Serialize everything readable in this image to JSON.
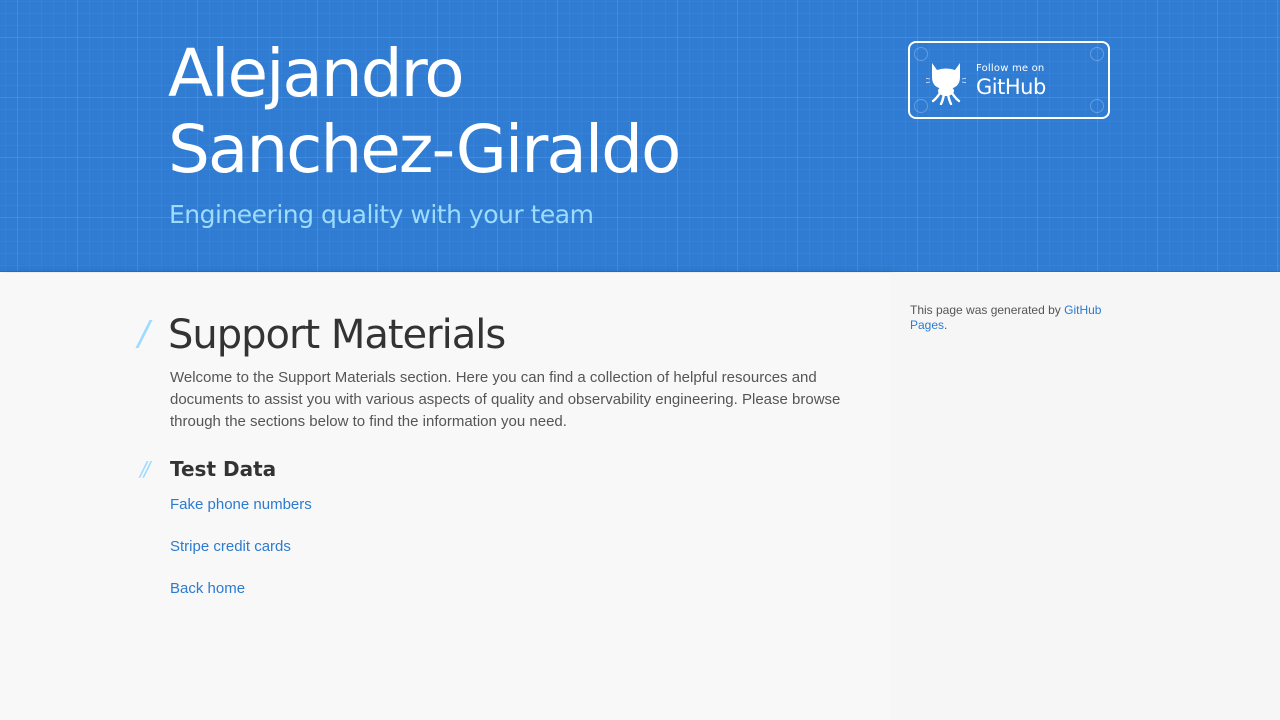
{
  "header": {
    "title_line1": "Alejandro",
    "title_line2": "Sanchez-Giraldo",
    "tagline": "Engineering quality with your team",
    "github_button": {
      "small_text": "Follow me on",
      "big_text": "GitHub",
      "icon": "octocat-icon"
    }
  },
  "main": {
    "page_title": "Support Materials",
    "intro": "Welcome to the Support Materials section. Here you can find a collection of helpful resources and documents to assist you with various aspects of quality and observability engineering. Please browse through the sections below to find the information you need.",
    "section_title": "Test Data",
    "links": [
      {
        "label": "Fake phone numbers"
      },
      {
        "label": "Stripe credit cards"
      },
      {
        "label": "Back home"
      }
    ]
  },
  "sidebar": {
    "generated_prefix": "This page was generated by ",
    "generated_link": "GitHub Pages",
    "generated_suffix": "."
  },
  "colors": {
    "header_bg": "#2f7cd2",
    "tagline": "#9ddcff",
    "link": "#2b7bd0",
    "heading": "#333333",
    "body_text": "#555555"
  }
}
